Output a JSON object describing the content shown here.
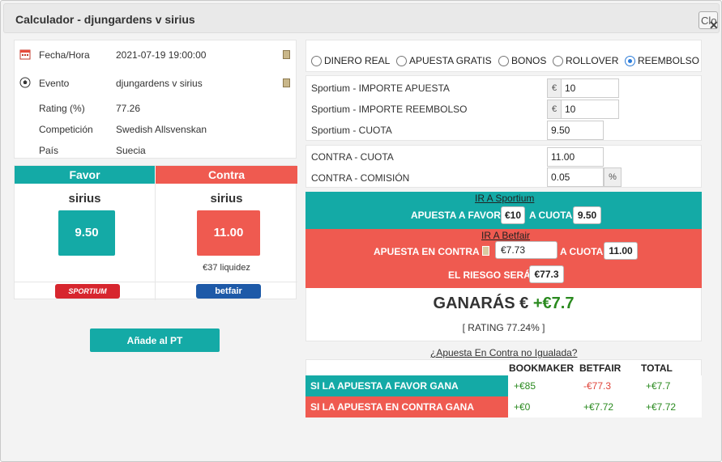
{
  "window": {
    "title": "Calculador - djungardens v sirius",
    "close_label": "Close"
  },
  "info": {
    "rows": [
      {
        "label": "Fecha/Hora",
        "value": "2021-07-19 19:00:00"
      },
      {
        "label": "Evento",
        "value": "djungardens v sirius"
      },
      {
        "label": "Rating (%)",
        "value": "77.26"
      },
      {
        "label": "Competición",
        "value": "Swedish Allsvenskan"
      },
      {
        "label": "País",
        "value": "Suecia"
      }
    ]
  },
  "favor": {
    "header": "Favor",
    "name": "sirius",
    "odds": "9.50",
    "bookmaker": "SPORTIUM"
  },
  "contra": {
    "header": "Contra",
    "name": "sirius",
    "odds": "11.00",
    "liquidity": "€37 liquidez",
    "exchange": "betfair"
  },
  "add_button": "Añade al PT",
  "bet_types": {
    "options": [
      "DINERO REAL",
      "APUESTA GRATIS",
      "BONOS",
      "ROLLOVER",
      "REEMBOLSO"
    ],
    "selected": "REEMBOLSO"
  },
  "bookmaker_form": {
    "stake_label": "Sportium - IMPORTE APUESTA",
    "stake_value": "10",
    "refund_label": "Sportium - IMPORTE REEMBOLSO",
    "refund_value": "10",
    "odds_label": "Sportium - CUOTA",
    "odds_value": "9.50",
    "currency": "€"
  },
  "lay_form": {
    "odds_label": "CONTRA - CUOTA",
    "odds_value": "11.00",
    "commission_label": "CONTRA - COMISIÓN",
    "commission_value": "0.05",
    "percent": "%"
  },
  "back_band": {
    "link": "IR A Sportium",
    "stake_label": "APUESTA A FAVOR",
    "stake_value": "€10",
    "odds_label": "A CUOTA",
    "odds_value": "9.50"
  },
  "lay_band": {
    "link": "IR A Betfair",
    "stake_label": "APUESTA EN CONTRA",
    "stake_value": "€7.73",
    "odds_label": "A CUOTA",
    "odds_value": "11.00",
    "risk_label": "EL RIESGO SERÁ",
    "risk_value": "€77.3"
  },
  "result": {
    "prefix": "GANARÁS €",
    "amount": "+€7.7",
    "rating": "[ RATING 77.24% ]"
  },
  "unmatched_link": "¿Apuesta En Contra no Igualada?",
  "outcomes": {
    "headers": [
      "BOOKMAKER",
      "BETFAIR",
      "TOTAL"
    ],
    "rows": [
      {
        "label": "SI LA APUESTA A FAVOR GANA",
        "bookmaker": "+€85",
        "betfair": "-€77.3",
        "total": "+€7.7"
      },
      {
        "label": "SI LA APUESTA EN CONTRA GANA",
        "bookmaker": "+€0",
        "betfair": "+€7.72",
        "total": "+€7.72"
      }
    ]
  },
  "colors": {
    "teal": "#14aaa6",
    "red": "#ef5a50",
    "green": "#2a8a1f"
  }
}
